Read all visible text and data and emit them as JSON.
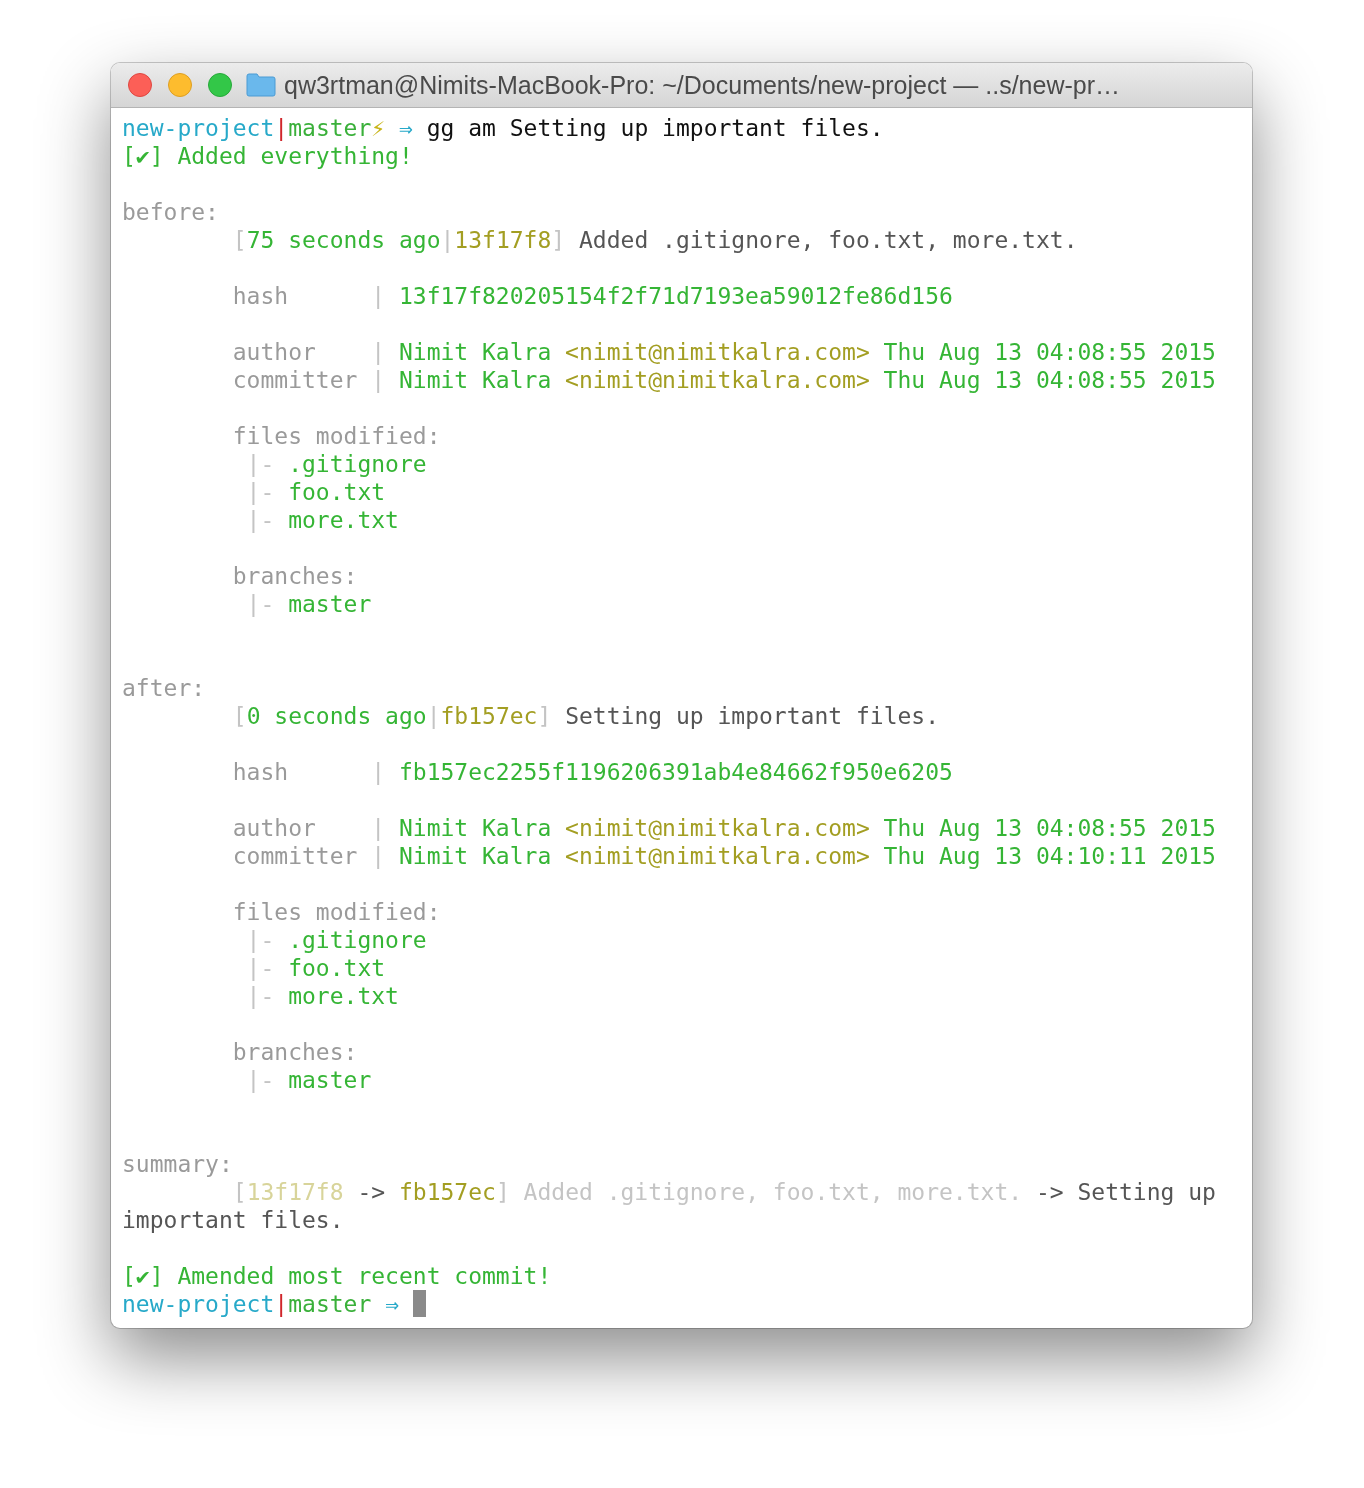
{
  "window": {
    "title": "qw3rtman@Nimits-MacBook-Pro: ~/Documents/new-project — ..s/new-pr…"
  },
  "terminal": {
    "lines": [
      {
        "kind": "prompt",
        "segments": [
          {
            "text": "new-project",
            "kind": "dir"
          },
          {
            "text": "|",
            "kind": "sep"
          },
          {
            "text": "master",
            "kind": "branch"
          },
          {
            "text": "⚡",
            "kind": "bolt"
          },
          {
            "text": "⇒",
            "kind": "arrow",
            "spaced": true
          },
          {
            "text": "gg am Setting up important files.",
            "kind": "cmd",
            "spaced": true
          }
        ]
      },
      {
        "kind": "plain",
        "segments": [
          {
            "text": "[✔] Added everything!",
            "kind": "ok"
          }
        ]
      },
      {
        "kind": "blank"
      },
      {
        "kind": "plain",
        "segments": [
          {
            "text": "before:",
            "kind": "label"
          }
        ]
      },
      {
        "kind": "indented",
        "segments": [
          {
            "text": "[",
            "kind": "dim"
          },
          {
            "text": "75 seconds ago",
            "kind": "green"
          },
          {
            "text": "|",
            "kind": "dim"
          },
          {
            "text": "13f17f8",
            "kind": "olive"
          },
          {
            "text": "]",
            "kind": "dim"
          },
          {
            "text": "Added .gitignore, foo.txt, more.txt.",
            "kind": "text",
            "spaced": true
          }
        ]
      },
      {
        "kind": "blank"
      },
      {
        "kind": "field",
        "label": "hash",
        "segments": [
          {
            "text": "|",
            "kind": "dim"
          },
          {
            "text": "13f17f820205154f2f71d7193ea59012fe86d156",
            "kind": "green",
            "spaced": true
          }
        ]
      },
      {
        "kind": "blank"
      },
      {
        "kind": "field",
        "label": "author",
        "segments": [
          {
            "text": "|",
            "kind": "dim"
          },
          {
            "text": "Nimit Kalra",
            "kind": "green",
            "spaced": true
          },
          {
            "text": "<nimit@nimitkalra.com>",
            "kind": "olive",
            "spaced": true
          },
          {
            "text": "Thu Aug 13 04:08:55 2015",
            "kind": "green",
            "spaced": true
          }
        ]
      },
      {
        "kind": "field",
        "label": "committer",
        "segments": [
          {
            "text": "|",
            "kind": "dim"
          },
          {
            "text": "Nimit Kalra",
            "kind": "green",
            "spaced": true
          },
          {
            "text": "<nimit@nimitkalra.com>",
            "kind": "olive",
            "spaced": true
          },
          {
            "text": "Thu Aug 13 04:08:55 2015",
            "kind": "green",
            "spaced": true
          }
        ]
      },
      {
        "kind": "blank"
      },
      {
        "kind": "indented",
        "segments": [
          {
            "text": "files modified:",
            "kind": "label"
          }
        ]
      },
      {
        "kind": "tree",
        "segments": [
          {
            "text": "|-",
            "kind": "dim"
          },
          {
            "text": ".gitignore",
            "kind": "green",
            "spaced": true
          }
        ]
      },
      {
        "kind": "tree",
        "segments": [
          {
            "text": "|-",
            "kind": "dim"
          },
          {
            "text": "foo.txt",
            "kind": "green",
            "spaced": true
          }
        ]
      },
      {
        "kind": "tree",
        "segments": [
          {
            "text": "|-",
            "kind": "dim"
          },
          {
            "text": "more.txt",
            "kind": "green",
            "spaced": true
          }
        ]
      },
      {
        "kind": "blank"
      },
      {
        "kind": "indented",
        "segments": [
          {
            "text": "branches:",
            "kind": "label"
          }
        ]
      },
      {
        "kind": "tree",
        "segments": [
          {
            "text": "|-",
            "kind": "dim"
          },
          {
            "text": "master",
            "kind": "green",
            "spaced": true
          }
        ]
      },
      {
        "kind": "blank"
      },
      {
        "kind": "blank"
      },
      {
        "kind": "plain",
        "segments": [
          {
            "text": "after:",
            "kind": "label"
          }
        ]
      },
      {
        "kind": "indented",
        "segments": [
          {
            "text": "[",
            "kind": "dim"
          },
          {
            "text": "0 seconds ago",
            "kind": "green"
          },
          {
            "text": "|",
            "kind": "dim"
          },
          {
            "text": "fb157ec",
            "kind": "olive"
          },
          {
            "text": "]",
            "kind": "dim"
          },
          {
            "text": "Setting up important files.",
            "kind": "text",
            "spaced": true
          }
        ]
      },
      {
        "kind": "blank"
      },
      {
        "kind": "field",
        "label": "hash",
        "segments": [
          {
            "text": "|",
            "kind": "dim"
          },
          {
            "text": "fb157ec2255f1196206391ab4e84662f950e6205",
            "kind": "green",
            "spaced": true
          }
        ]
      },
      {
        "kind": "blank"
      },
      {
        "kind": "field",
        "label": "author",
        "segments": [
          {
            "text": "|",
            "kind": "dim"
          },
          {
            "text": "Nimit Kalra",
            "kind": "green",
            "spaced": true
          },
          {
            "text": "<nimit@nimitkalra.com>",
            "kind": "olive",
            "spaced": true
          },
          {
            "text": "Thu Aug 13 04:08:55 2015",
            "kind": "green",
            "spaced": true
          }
        ]
      },
      {
        "kind": "field",
        "label": "committer",
        "segments": [
          {
            "text": "|",
            "kind": "dim"
          },
          {
            "text": "Nimit Kalra",
            "kind": "green",
            "spaced": true
          },
          {
            "text": "<nimit@nimitkalra.com>",
            "kind": "olive",
            "spaced": true
          },
          {
            "text": "Thu Aug 13 04:10:11 2015",
            "kind": "green",
            "spaced": true
          }
        ]
      },
      {
        "kind": "blank"
      },
      {
        "kind": "indented",
        "segments": [
          {
            "text": "files modified:",
            "kind": "label"
          }
        ]
      },
      {
        "kind": "tree",
        "segments": [
          {
            "text": "|-",
            "kind": "dim"
          },
          {
            "text": ".gitignore",
            "kind": "green",
            "spaced": true
          }
        ]
      },
      {
        "kind": "tree",
        "segments": [
          {
            "text": "|-",
            "kind": "dim"
          },
          {
            "text": "foo.txt",
            "kind": "green",
            "spaced": true
          }
        ]
      },
      {
        "kind": "tree",
        "segments": [
          {
            "text": "|-",
            "kind": "dim"
          },
          {
            "text": "more.txt",
            "kind": "green",
            "spaced": true
          }
        ]
      },
      {
        "kind": "blank"
      },
      {
        "kind": "indented",
        "segments": [
          {
            "text": "branches:",
            "kind": "label"
          }
        ]
      },
      {
        "kind": "tree",
        "segments": [
          {
            "text": "|-",
            "kind": "dim"
          },
          {
            "text": "master",
            "kind": "green",
            "spaced": true
          }
        ]
      },
      {
        "kind": "blank"
      },
      {
        "kind": "blank"
      },
      {
        "kind": "plain",
        "segments": [
          {
            "text": "summary:",
            "kind": "label"
          }
        ]
      },
      {
        "kind": "indented",
        "segments": [
          {
            "text": "[",
            "kind": "dim"
          },
          {
            "text": "13f17f8",
            "kind": "faded"
          },
          {
            "text": "->",
            "kind": "text",
            "spaced": true
          },
          {
            "text": "fb157ec",
            "kind": "olive",
            "spaced": true
          },
          {
            "text": "]",
            "kind": "dim"
          },
          {
            "text": "Added .gitignore, foo.txt, more.txt.",
            "kind": "dim",
            "spaced": true
          },
          {
            "text": "->",
            "kind": "text",
            "spaced": true
          },
          {
            "text": "Setting up",
            "kind": "text",
            "spaced": true
          }
        ]
      },
      {
        "kind": "plain",
        "segments": [
          {
            "text": "important files.",
            "kind": "text"
          }
        ]
      },
      {
        "kind": "blank"
      },
      {
        "kind": "plain",
        "segments": [
          {
            "text": "[✔] Amended most recent commit!",
            "kind": "ok"
          }
        ]
      },
      {
        "kind": "prompt",
        "cursor": true,
        "segments": [
          {
            "text": "new-project",
            "kind": "dir"
          },
          {
            "text": "|",
            "kind": "sep"
          },
          {
            "text": "master",
            "kind": "branch"
          },
          {
            "text": "⇒",
            "kind": "arrow",
            "spaced": true
          }
        ]
      }
    ]
  }
}
